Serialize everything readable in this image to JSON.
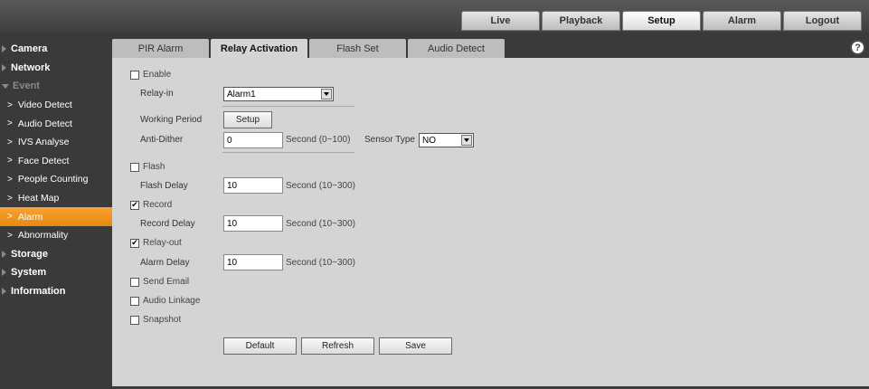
{
  "top_nav": [
    "Live",
    "Playback",
    "Setup",
    "Alarm",
    "Logout"
  ],
  "top_nav_active": 2,
  "sidebar": {
    "sections": [
      {
        "label": "Camera"
      },
      {
        "label": "Network"
      },
      {
        "label": "Event"
      }
    ],
    "event_items": [
      "Video Detect",
      "Audio Detect",
      "IVS Analyse",
      "Face Detect",
      "People Counting",
      "Heat Map",
      "Alarm",
      "Abnormality"
    ],
    "active_item": "Alarm",
    "bottom_sections": [
      {
        "label": "Storage"
      },
      {
        "label": "System"
      },
      {
        "label": "Information"
      }
    ]
  },
  "subtabs": [
    "PIR Alarm",
    "Relay Activation",
    "Flash Set",
    "Audio Detect"
  ],
  "subtab_active": 1,
  "form": {
    "enable_label": "Enable",
    "enable_checked": false,
    "relay_in_label": "Relay-in",
    "relay_in_value": "Alarm1",
    "working_period_label": "Working Period",
    "working_period_button": "Setup",
    "anti_dither_label": "Anti-Dither",
    "anti_dither_value": "0",
    "anti_dither_unit": "Second (0~100)",
    "sensor_type_label": "Sensor Type",
    "sensor_type_value": "NO",
    "flash_label": "Flash",
    "flash_checked": false,
    "flash_delay_label": "Flash Delay",
    "flash_delay_value": "10",
    "flash_delay_unit": "Second (10~300)",
    "record_label": "Record",
    "record_checked": true,
    "record_delay_label": "Record Delay",
    "record_delay_value": "10",
    "record_delay_unit": "Second (10~300)",
    "relay_out_label": "Relay-out",
    "relay_out_checked": true,
    "alarm_delay_label": "Alarm Delay",
    "alarm_delay_value": "10",
    "alarm_delay_unit": "Second (10~300)",
    "send_email_label": "Send Email",
    "audio_linkage_label": "Audio Linkage",
    "snapshot_label": "Snapshot",
    "check_mark": "✔"
  },
  "buttons": {
    "default": "Default",
    "refresh": "Refresh",
    "save": "Save"
  },
  "help_icon": "?"
}
